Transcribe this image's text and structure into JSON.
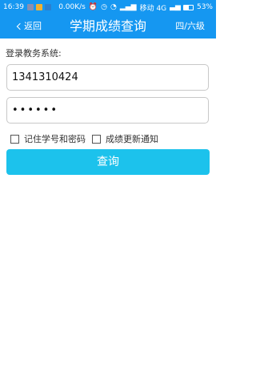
{
  "status_bar": {
    "time": "16:39",
    "network_speed": "0.00K/s",
    "carrier": "移动 4G",
    "battery": "53%",
    "battery_level": 0.53,
    "app_icon_colors": [
      "#8a8fb0",
      "#f0b030",
      "#2a7fd0"
    ]
  },
  "nav": {
    "back_label": "返回",
    "title": "学期成绩查询",
    "right_label": "四/六级"
  },
  "form": {
    "label": "登录教务系统:",
    "username_value": "1341310424",
    "password_value": "••••••",
    "remember_label": "记住学号和密码",
    "notify_label": "成绩更新通知",
    "submit_label": "查询"
  },
  "colors": {
    "primary": "#1597f1",
    "button": "#1cc2ec"
  }
}
